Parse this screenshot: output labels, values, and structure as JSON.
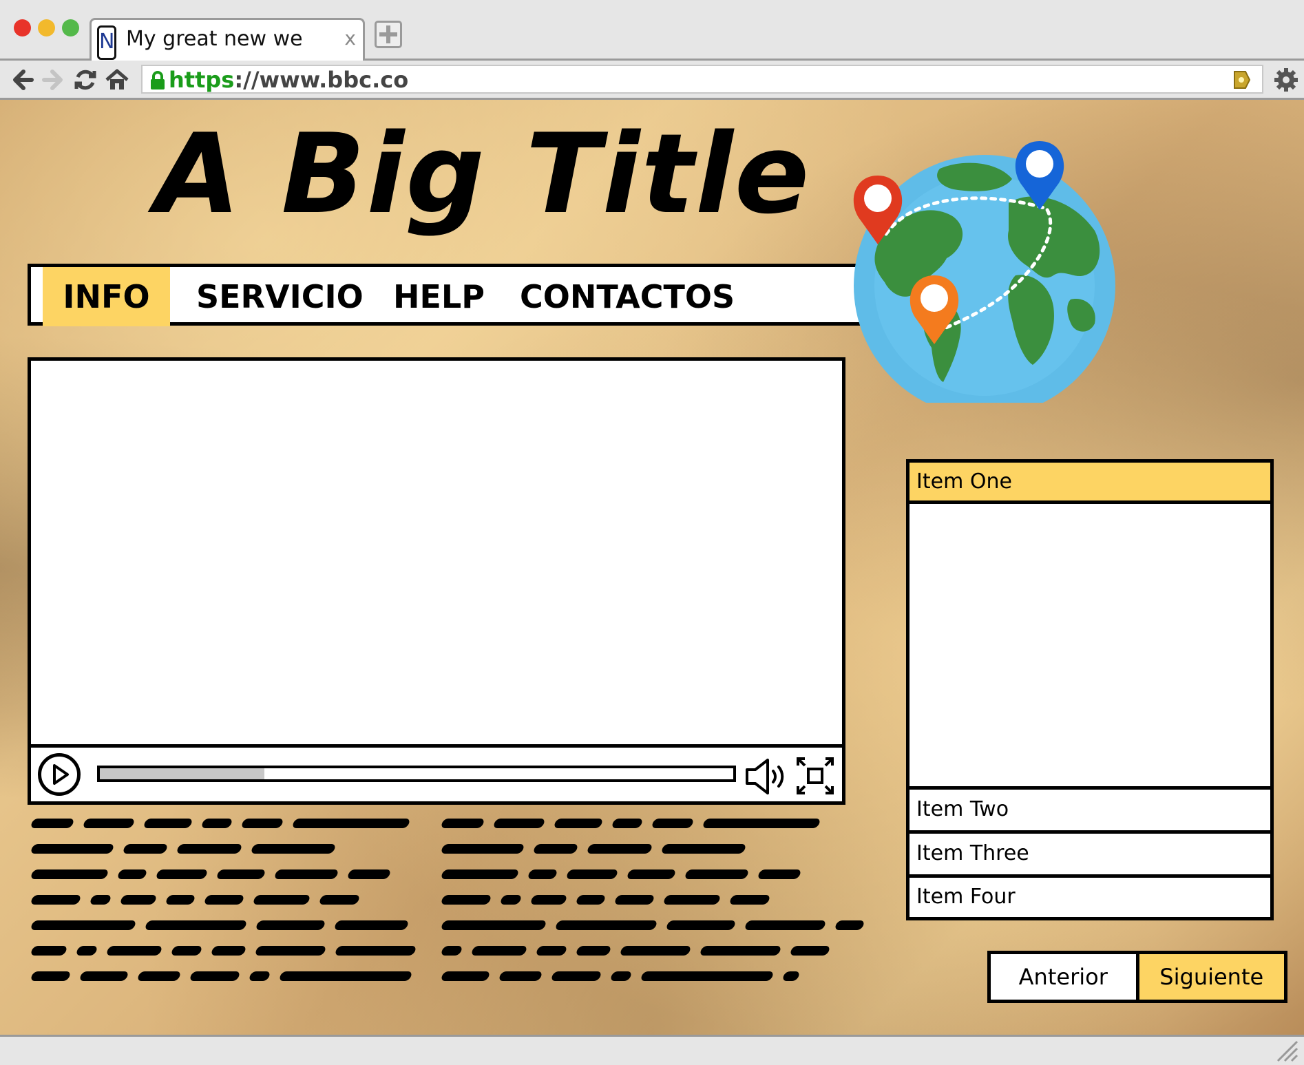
{
  "browser": {
    "tab_title": "My great new we",
    "tab_close": "x",
    "favicon_letter": "N",
    "url_protocol": "https",
    "url_rest": "://www.bbc.co"
  },
  "page": {
    "title": "A Big Title",
    "nav": [
      {
        "label": "INFO",
        "active": true
      },
      {
        "label": "SERVICIO",
        "active": false
      },
      {
        "label": "HELP",
        "active": false
      },
      {
        "label": "CONTACTOS",
        "active": false
      }
    ],
    "video": {
      "progress_fraction": 0.26
    },
    "list": [
      {
        "label": "Item One",
        "active": true
      },
      {
        "label": "Item Two",
        "active": false
      },
      {
        "label": "Item Three",
        "active": false
      },
      {
        "label": "Item Four",
        "active": false
      }
    ],
    "pager": {
      "prev_label": "Anterior",
      "next_label": "Siguiente"
    }
  },
  "colors": {
    "accent_yellow": "#fdd463",
    "secure_green": "#1a9c1a",
    "globe_ocean": "#5fbce8",
    "globe_land": "#3b8f3e",
    "pin_red": "#e03a1f",
    "pin_blue": "#1565d8",
    "pin_orange": "#f47b1e"
  },
  "icons": [
    "back-arrow-icon",
    "forward-arrow-icon",
    "reload-icon",
    "home-icon",
    "lock-icon",
    "bookmark-icon",
    "gear-icon",
    "play-icon",
    "volume-icon",
    "fullscreen-icon",
    "globe-icon",
    "map-pin-icon",
    "resize-grip-icon"
  ]
}
